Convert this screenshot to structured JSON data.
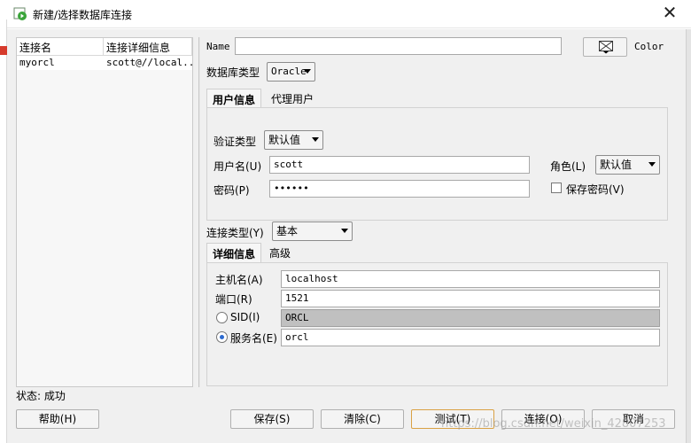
{
  "window": {
    "title": "新建/选择数据库连接",
    "close_glyph": "✕"
  },
  "conn_list": {
    "headers": [
      "连接名",
      "连接详细信息"
    ],
    "rows": [
      {
        "name": "myorcl",
        "detail": "scott@//local..."
      }
    ]
  },
  "status": "状态: 成功",
  "form": {
    "name_label": "Name",
    "name_value": "",
    "color_label": "Color",
    "db_type_label": "数据库类型",
    "db_type_value": "Oracle",
    "tabs_user": [
      "用户信息",
      "代理用户"
    ],
    "auth_type_label": "验证类型",
    "auth_type_value": "默认值",
    "username_label": "用户名(U)",
    "username_value": "scott",
    "role_label": "角色(L)",
    "role_value": "默认值",
    "password_label": "密码(P)",
    "password_value": "••••••",
    "save_password_label": "保存密码(V)",
    "conn_type_label": "连接类型(Y)",
    "conn_type_value": "基本",
    "tabs_detail": [
      "详细信息",
      "高级"
    ],
    "host_label": "主机名(A)",
    "host_value": "localhost",
    "port_label": "端口(R)",
    "port_value": "1521",
    "sid_label": "SID(I)",
    "sid_value": "ORCL",
    "service_label": "服务名(E)",
    "service_value": "orcl"
  },
  "buttons": {
    "help": "帮助(H)",
    "save": "保存(S)",
    "clear": "清除(C)",
    "test": "测试(T)",
    "connect": "连接(O)",
    "cancel": "取消"
  },
  "watermark": "https://blog.csdn.net/weixin_42807253"
}
